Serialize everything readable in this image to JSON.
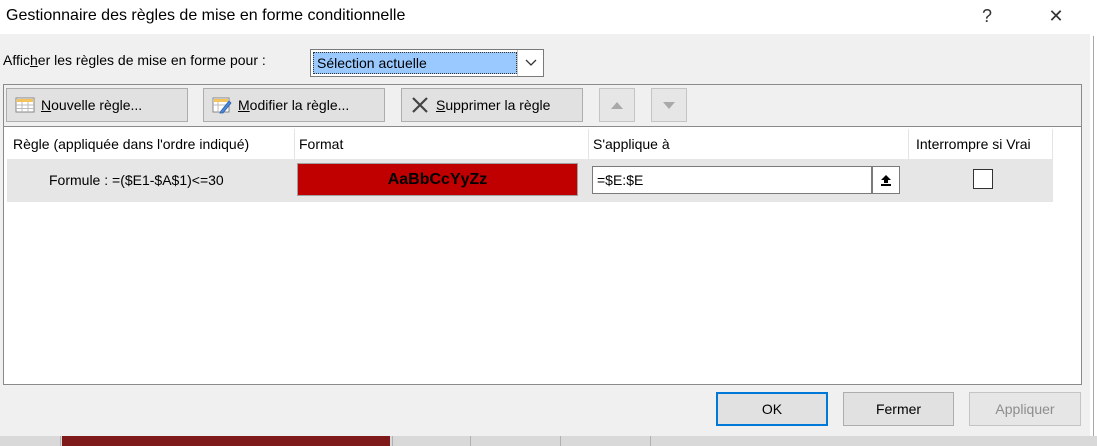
{
  "dialog": {
    "title": "Gestionnaire des règles de mise en forme conditionnelle",
    "help_label": "?",
    "close_label": "✕"
  },
  "scope": {
    "label_prefix": "Affic",
    "label_mnemonic": "h",
    "label_suffix": "er les règles de mise en forme pour :",
    "selected": "Sélection actuelle"
  },
  "toolbar": {
    "new_mnemonic": "N",
    "new_rest": "ouvelle règle...",
    "edit_mnemonic": "M",
    "edit_rest": "odifier la règle...",
    "delete_mnemonic": "S",
    "delete_rest": "upprimer la règle"
  },
  "table": {
    "headers": [
      "Règle (appliquée dans l'ordre indiqué)",
      "Format",
      "S'applique à",
      "Interrompre si Vrai"
    ],
    "rows": [
      {
        "rule": "Formule : =($E1-$A$1)<=30",
        "format_preview": "AaBbCcYyZz",
        "format_fill": "#c00000",
        "applies_to": "=$E:$E",
        "stop_if_true": false
      }
    ]
  },
  "buttons": {
    "ok": "OK",
    "cancel": "Fermer",
    "apply": "Appliquer"
  },
  "colors": {
    "accent": "#0078d7",
    "selection": "#99c9ff"
  }
}
